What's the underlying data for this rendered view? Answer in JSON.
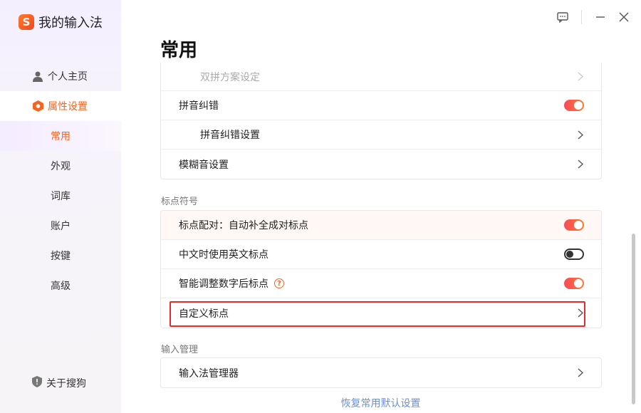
{
  "app": {
    "title": "我的输入法",
    "logo_letter": "S"
  },
  "sidebar": {
    "items": [
      {
        "label": "个人主页",
        "icon": "person-icon"
      },
      {
        "label": "属性设置",
        "icon": "settings-hex-icon"
      }
    ],
    "subitems": [
      {
        "label": "常用",
        "active": true
      },
      {
        "label": "外观"
      },
      {
        "label": "词库"
      },
      {
        "label": "账户"
      },
      {
        "label": "按键"
      },
      {
        "label": "高级"
      }
    ],
    "about": {
      "label": "关于搜狗",
      "icon": "shield-icon"
    }
  },
  "window": {
    "controls": [
      "feedback-icon",
      "minimize-icon",
      "close-icon"
    ]
  },
  "main": {
    "title": "常用",
    "card1": {
      "rows": [
        {
          "label": "双拼方案设定",
          "control": "chevron",
          "faded": true
        },
        {
          "label": "拼音纠错",
          "control": "toggle",
          "value": true
        },
        {
          "label": "拼音纠错设置",
          "control": "chevron"
        },
        {
          "label": "模糊音设置",
          "control": "chevron"
        }
      ]
    },
    "punct_section": {
      "label": "标点符号",
      "rows": [
        {
          "label": "标点配对：自动补全成对标点",
          "control": "toggle",
          "value": true
        },
        {
          "label": "中文时使用英文标点",
          "control": "toggle",
          "value": false
        },
        {
          "label": "智能调整数字后标点",
          "control": "toggle",
          "value": true,
          "help": "?"
        },
        {
          "label": "自定义标点",
          "control": "chevron"
        }
      ]
    },
    "input_section": {
      "label": "输入管理",
      "rows": [
        {
          "label": "输入法管理器",
          "control": "chevron"
        }
      ]
    },
    "restore_link": "恢复常用默认设置"
  },
  "colors": {
    "accent": "#f26522",
    "toggle_on": "#f74a5c",
    "link": "#6b8fd6",
    "highlight_box": "#e52b2b"
  }
}
